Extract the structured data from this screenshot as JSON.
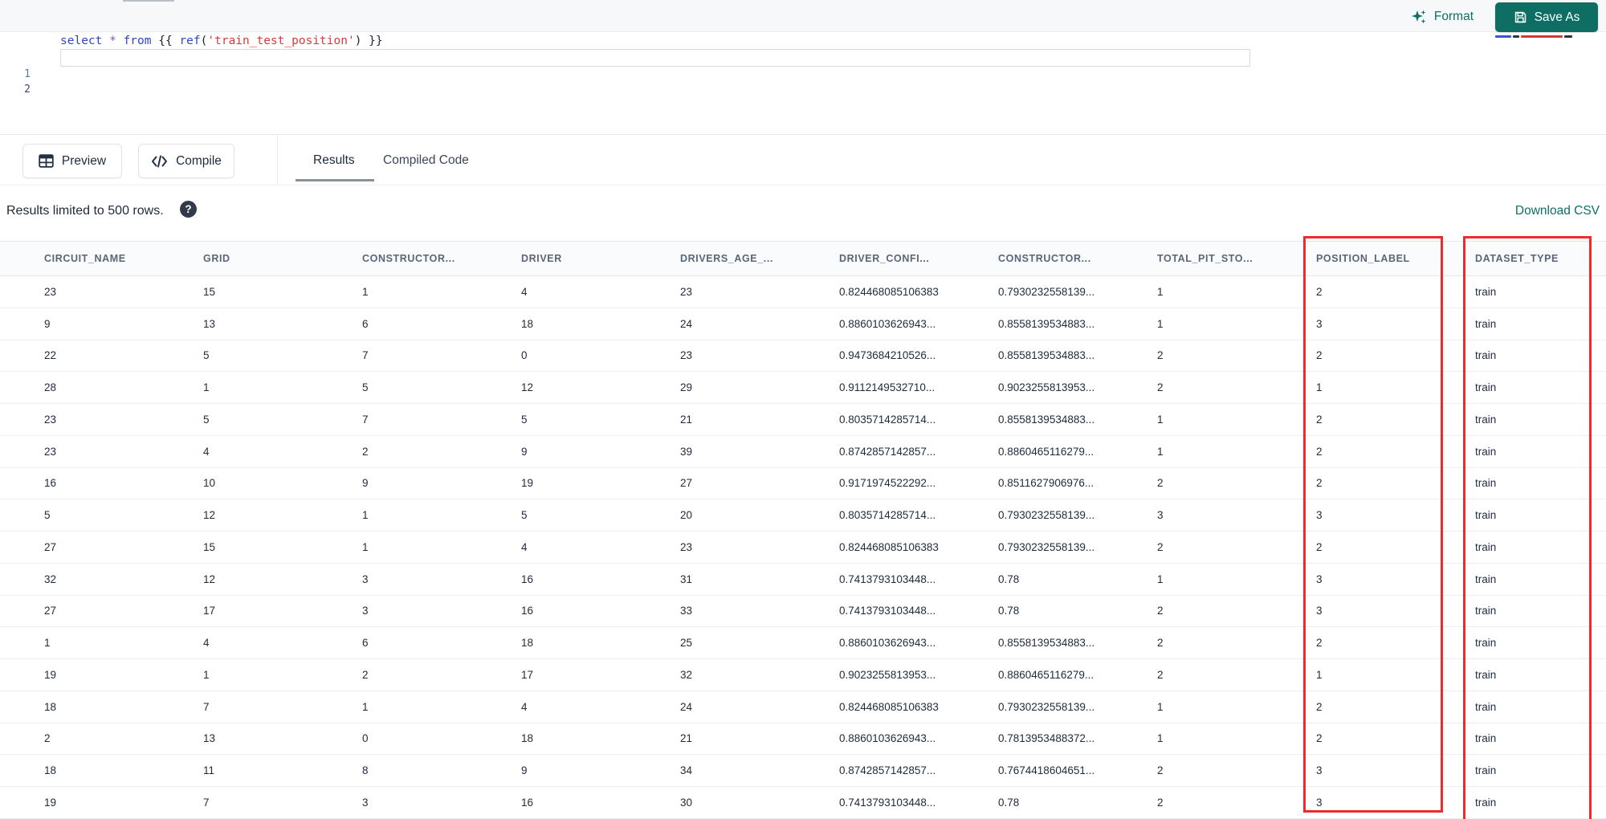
{
  "topbar": {
    "format_label": "Format",
    "save_as_label": "Save As"
  },
  "editor": {
    "line1_number": "1",
    "line2_number": "2",
    "code_tokens": [
      {
        "text": "select ",
        "type": "keyword"
      },
      {
        "text": "* ",
        "type": "operator"
      },
      {
        "text": "from ",
        "type": "keyword"
      },
      {
        "text": "{{ ",
        "type": "brace"
      },
      {
        "text": "ref",
        "type": "function"
      },
      {
        "text": "(",
        "type": "brace"
      },
      {
        "text": "'train_test_position'",
        "type": "string"
      },
      {
        "text": ") ",
        "type": "brace"
      },
      {
        "text": "}}",
        "type": "brace"
      }
    ]
  },
  "toolbar": {
    "preview_label": "Preview",
    "compile_label": "Compile",
    "tabs": [
      {
        "label": "Results",
        "active": true
      },
      {
        "label": "Compiled Code",
        "active": false
      }
    ]
  },
  "status": {
    "message": "Results limited to 500 rows.",
    "help_glyph": "?",
    "download_label": "Download CSV"
  },
  "table": {
    "columns": [
      "CIRCUIT_NAME",
      "GRID",
      "CONSTRUCTOR...",
      "DRIVER",
      "DRIVERS_AGE_...",
      "DRIVER_CONFI...",
      "CONSTRUCTOR...",
      "TOTAL_PIT_STO...",
      "POSITION_LABEL",
      "DATASET_TYPE"
    ],
    "highlighted_columns": [
      "POSITION_LABEL",
      "DATASET_TYPE"
    ],
    "rows": [
      [
        "23",
        "15",
        "1",
        "4",
        "23",
        "0.824468085106383",
        "0.7930232558139...",
        "1",
        "2",
        "train"
      ],
      [
        "9",
        "13",
        "6",
        "18",
        "24",
        "0.8860103626943...",
        "0.8558139534883...",
        "1",
        "3",
        "train"
      ],
      [
        "22",
        "5",
        "7",
        "0",
        "23",
        "0.9473684210526...",
        "0.8558139534883...",
        "2",
        "2",
        "train"
      ],
      [
        "28",
        "1",
        "5",
        "12",
        "29",
        "0.9112149532710...",
        "0.9023255813953...",
        "2",
        "1",
        "train"
      ],
      [
        "23",
        "5",
        "7",
        "5",
        "21",
        "0.8035714285714...",
        "0.8558139534883...",
        "1",
        "2",
        "train"
      ],
      [
        "23",
        "4",
        "2",
        "9",
        "39",
        "0.8742857142857...",
        "0.8860465116279...",
        "1",
        "2",
        "train"
      ],
      [
        "16",
        "10",
        "9",
        "19",
        "27",
        "0.9171974522292...",
        "0.8511627906976...",
        "2",
        "2",
        "train"
      ],
      [
        "5",
        "12",
        "1",
        "5",
        "20",
        "0.8035714285714...",
        "0.7930232558139...",
        "3",
        "3",
        "train"
      ],
      [
        "27",
        "15",
        "1",
        "4",
        "23",
        "0.824468085106383",
        "0.7930232558139...",
        "2",
        "2",
        "train"
      ],
      [
        "32",
        "12",
        "3",
        "16",
        "31",
        "0.7413793103448...",
        "0.78",
        "1",
        "3",
        "train"
      ],
      [
        "27",
        "17",
        "3",
        "16",
        "33",
        "0.7413793103448...",
        "0.78",
        "2",
        "3",
        "train"
      ],
      [
        "1",
        "4",
        "6",
        "18",
        "25",
        "0.8860103626943...",
        "0.8558139534883...",
        "2",
        "2",
        "train"
      ],
      [
        "19",
        "1",
        "2",
        "17",
        "32",
        "0.9023255813953...",
        "0.8860465116279...",
        "2",
        "1",
        "train"
      ],
      [
        "18",
        "7",
        "1",
        "4",
        "24",
        "0.824468085106383",
        "0.7930232558139...",
        "1",
        "2",
        "train"
      ],
      [
        "2",
        "13",
        "0",
        "18",
        "21",
        "0.8860103626943...",
        "0.7813953488372...",
        "1",
        "2",
        "train"
      ],
      [
        "18",
        "11",
        "8",
        "9",
        "34",
        "0.8742857142857...",
        "0.7674418604651...",
        "2",
        "3",
        "train"
      ],
      [
        "19",
        "7",
        "3",
        "16",
        "30",
        "0.7413793103448...",
        "0.78",
        "2",
        "3",
        "train"
      ]
    ]
  },
  "colors": {
    "accent_teal": "#0e6f66",
    "highlight_red": "#ee2b2b",
    "text_dark": "#1f2a3c",
    "header_text": "#5a6577"
  }
}
